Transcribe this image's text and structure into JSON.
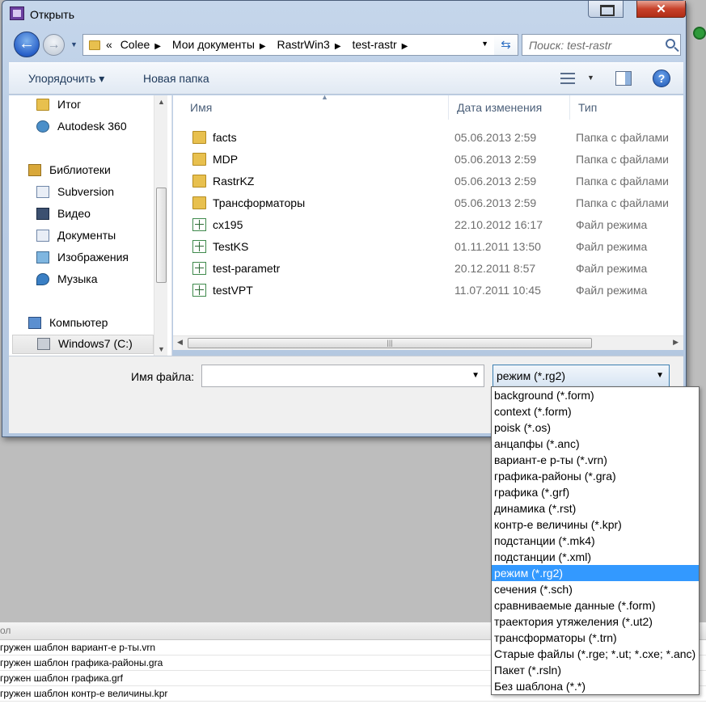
{
  "window": {
    "title": "Открыть"
  },
  "address": {
    "crumbs": [
      "«",
      "Colee",
      "Мои документы",
      "RastrWin3",
      "test-rastr"
    ]
  },
  "search": {
    "placeholder": "Поиск: test-rastr"
  },
  "toolbar": {
    "organize": "Упорядочить ▾",
    "new_folder": "Новая папка"
  },
  "nav": {
    "items": [
      {
        "label": "Итог",
        "icon": "folder-icon"
      },
      {
        "label": "Autodesk 360",
        "icon": "cloud-icon"
      },
      {
        "label": "Библиотеки",
        "icon": "libraries-icon"
      },
      {
        "label": "Subversion",
        "icon": "document-icon"
      },
      {
        "label": "Видео",
        "icon": "video-icon"
      },
      {
        "label": "Документы",
        "icon": "document-icon"
      },
      {
        "label": "Изображения",
        "icon": "pictures-icon"
      },
      {
        "label": "Музыка",
        "icon": "music-icon"
      },
      {
        "label": "Компьютер",
        "icon": "computer-icon"
      },
      {
        "label": "Windows7 (C:)",
        "icon": "drive-icon"
      }
    ]
  },
  "columns": {
    "name": "Имя",
    "date": "Дата изменения",
    "type": "Тип"
  },
  "files": [
    {
      "name": "facts",
      "date": "05.06.2013 2:59",
      "type": "Папка с файлами",
      "icon": "folder-icon"
    },
    {
      "name": "MDP",
      "date": "05.06.2013 2:59",
      "type": "Папка с файлами",
      "icon": "folder-icon"
    },
    {
      "name": "RastrKZ",
      "date": "05.06.2013 2:59",
      "type": "Папка с файлами",
      "icon": "folder-icon"
    },
    {
      "name": "Трансформаторы",
      "date": "05.06.2013 2:59",
      "type": "Папка с файлами",
      "icon": "folder-icon"
    },
    {
      "name": "cx195",
      "date": "22.10.2012 16:17",
      "type": "Файл режима",
      "icon": "rg2-file-icon"
    },
    {
      "name": "TestKS",
      "date": "01.11.2011 13:50",
      "type": "Файл режима",
      "icon": "rg2-file-icon"
    },
    {
      "name": "test-parametr",
      "date": "20.12.2011 8:57",
      "type": "Файл режима",
      "icon": "rg2-file-icon"
    },
    {
      "name": "testVPT",
      "date": "11.07.2011 10:45",
      "type": "Файл режима",
      "icon": "rg2-file-icon"
    }
  ],
  "filename": {
    "label": "Имя файла:",
    "value": ""
  },
  "filter": {
    "selected": "режим (*.rg2)",
    "options": [
      "background (*.form)",
      "context (*.form)",
      "poisk (*.os)",
      "анцапфы (*.anc)",
      "вариант-е р-ты (*.vrn)",
      "графика-районы (*.gra)",
      "графика (*.grf)",
      "динамика (*.rst)",
      "контр-е величины (*.kpr)",
      "подстанции (*.mk4)",
      "подстанции (*.xml)",
      "режим (*.rg2)",
      "сечения (*.sch)",
      "сравниваемые данные (*.form)",
      "траектория утяжеления (*.ut2)",
      "трансформаторы (*.trn)",
      "Старые файлы (*.rge; *.ut; *.cxe; *.anc)",
      "Пакет (*.rsln)",
      "Без шаблона (*.*)"
    ],
    "selected_index": 11
  },
  "background_log": {
    "header": "ол",
    "rows": [
      "гружен шаблон вариант-е р-ты.vrn",
      "гружен шаблон графика-районы.gra",
      "гружен шаблон графика.grf",
      "гружен шаблон контр-е величины.kpr"
    ]
  }
}
